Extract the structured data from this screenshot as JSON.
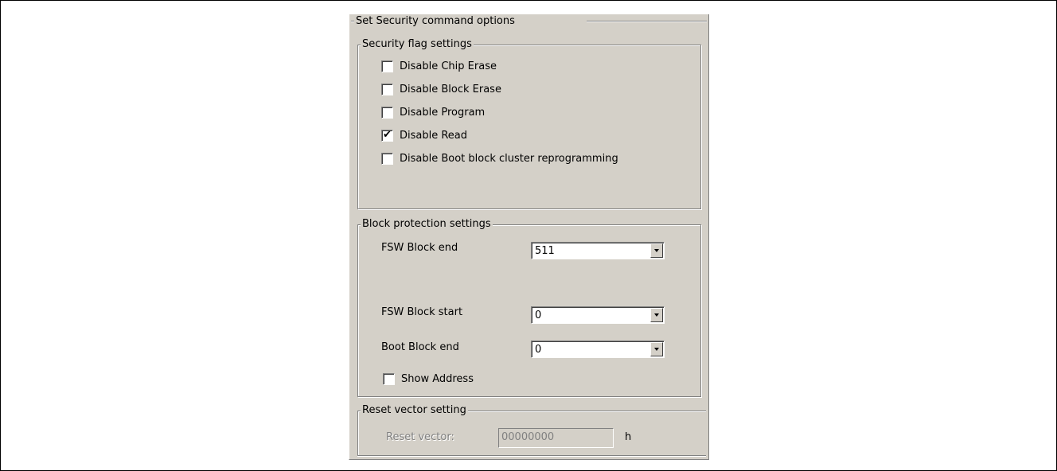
{
  "outer_group": {
    "title": "Set Security command options"
  },
  "security_flags": {
    "title": "Security flag settings",
    "items": [
      {
        "label": "Disable Chip Erase",
        "checked": false
      },
      {
        "label": "Disable Block Erase",
        "checked": false
      },
      {
        "label": "Disable Program",
        "checked": false
      },
      {
        "label": "Disable Read",
        "checked": true
      },
      {
        "label": "Disable Boot block cluster reprogramming",
        "checked": false
      }
    ]
  },
  "block_protection": {
    "title": "Block protection settings",
    "fsw_block_end": {
      "label": "FSW Block end",
      "value": "511"
    },
    "fsw_block_start": {
      "label": "FSW Block start",
      "value": "0"
    },
    "boot_block_end": {
      "label": "Boot Block end",
      "value": "0"
    },
    "show_address": {
      "label": "Show Address",
      "checked": false
    }
  },
  "reset_vector": {
    "title": "Reset vector setting",
    "label": "Reset vector:",
    "value": "00000000",
    "suffix": "h"
  },
  "check_glyph": "✔"
}
